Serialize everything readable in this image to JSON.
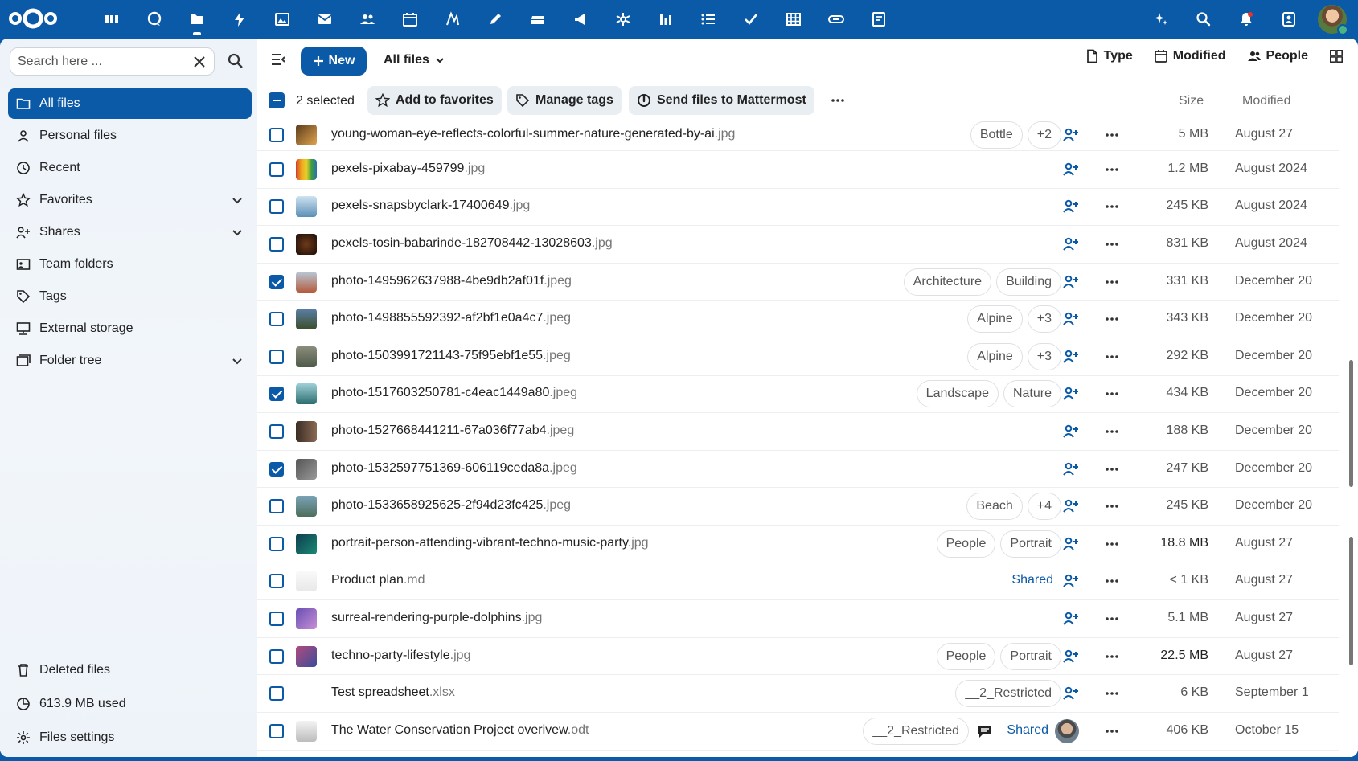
{
  "colors": {
    "brand": "#0b5aa7",
    "sidebar_bg": "#eef3f9",
    "selected_bg": "#0b5aa7"
  },
  "topbar": {
    "apps": [
      "dashboard-icon",
      "talk-icon",
      "files-icon",
      "activity-icon",
      "photos-icon",
      "mail-icon",
      "contacts-icon",
      "calendar-icon",
      "text-icon",
      "notes-icon",
      "deck-icon",
      "announcement-icon",
      "spreed-icon",
      "analytics-icon",
      "tasks-icon",
      "checklist-icon",
      "tables-icon",
      "links-icon",
      "forms-icon"
    ],
    "right": [
      "assistant-icon",
      "unified-search-icon",
      "notifications-icon",
      "contacts-menu-icon"
    ]
  },
  "sidebar": {
    "search": {
      "placeholder": "Search here ..."
    },
    "items": [
      {
        "label": "All files",
        "icon": "folder-icon"
      },
      {
        "label": "Personal files",
        "icon": "account-icon"
      },
      {
        "label": "Recent",
        "icon": "history-icon"
      },
      {
        "label": "Favorites",
        "icon": "star-icon"
      },
      {
        "label": "Shares",
        "icon": "share-icon"
      },
      {
        "label": "Team folders",
        "icon": "team-folder-icon"
      },
      {
        "label": "Tags",
        "icon": "tag-icon"
      },
      {
        "label": "External storage",
        "icon": "external-storage-icon"
      },
      {
        "label": "Folder tree",
        "icon": "folder-tree-icon"
      }
    ],
    "bottom": [
      {
        "label": "Deleted files",
        "icon": "trash-icon"
      },
      {
        "label": "613.9 MB used",
        "icon": "storage-pie-icon"
      },
      {
        "label": "Files settings",
        "icon": "cog-icon"
      }
    ]
  },
  "toolbar": {
    "new_label": "New",
    "breadcrumb": "All files",
    "view": {
      "type": "Type",
      "modified": "Modified",
      "people": "People"
    }
  },
  "selection": {
    "count_label": "2 selected",
    "actions": [
      "Add to favorites",
      "Manage tags",
      "Send files to Mattermost"
    ]
  },
  "columns": {
    "size": "Size",
    "modified": "Modified"
  },
  "files": [
    {
      "base": "young-woman-eye-reflects-colorful-summer-nature-generated-by-ai",
      "ext": ".jpg",
      "tags": [
        "Bottle",
        "+2"
      ],
      "size": "5 MB",
      "modified": "August 27",
      "checked": false,
      "thumb": "linear-gradient(135deg,#5a3b1c,#e1a54d)"
    },
    {
      "base": "pexels-pixabay-459799",
      "ext": ".jpg",
      "tags": [],
      "size": "1.2 MB",
      "modified": "August 2024",
      "checked": false,
      "thumb": "linear-gradient(90deg,#d13a2e,#f0a11c,#e9d12c,#3c9d3f,#2b6fb3)"
    },
    {
      "base": "pexels-snapsbyclark-17400649",
      "ext": ".jpg",
      "tags": [],
      "size": "245 KB",
      "modified": "August 2024",
      "checked": false,
      "thumb": "linear-gradient(180deg,#cfe3f1,#5c8fb6)"
    },
    {
      "base": "pexels-tosin-babarinde-182708442-13028603",
      "ext": ".jpg",
      "tags": [],
      "size": "831 KB",
      "modified": "August 2024",
      "checked": false,
      "thumb": "radial-gradient(circle,#6e3a1a,#1c0d06)"
    },
    {
      "base": "photo-1495962637988-4be9db2af01f",
      "ext": ".jpeg",
      "tags": [
        "Architecture",
        "Building"
      ],
      "size": "331 KB",
      "modified": "December 20",
      "checked": true,
      "thumb": "linear-gradient(180deg,#b9c9d8,#b45c3e)"
    },
    {
      "base": "photo-1498855592392-af2bf1e0a4c7",
      "ext": ".jpeg",
      "tags": [
        "Alpine",
        "+3"
      ],
      "size": "343 KB",
      "modified": "December 20",
      "checked": false,
      "thumb": "linear-gradient(180deg,#5b7fa8,#3b4d2a)"
    },
    {
      "base": "photo-1503991721143-75f95ebf1e55",
      "ext": ".jpeg",
      "tags": [
        "Alpine",
        "+3"
      ],
      "size": "292 KB",
      "modified": "December 20",
      "checked": false,
      "thumb": "linear-gradient(180deg,#8a8d7a,#4f5a4a)"
    },
    {
      "base": "photo-1517603250781-c4eac1449a80",
      "ext": ".jpeg",
      "tags": [
        "Landscape",
        "Nature"
      ],
      "size": "434 KB",
      "modified": "December 20",
      "checked": true,
      "thumb": "linear-gradient(180deg,#9fd0d8,#2b6d6e)"
    },
    {
      "base": "photo-1527668441211-67a036f77ab4",
      "ext": ".jpeg",
      "tags": [],
      "size": "188 KB",
      "modified": "December 20",
      "checked": false,
      "thumb": "linear-gradient(90deg,#3a2c24,#8a6a54)"
    },
    {
      "base": "photo-1532597751369-606119ceda8a",
      "ext": ".jpeg",
      "tags": [],
      "size": "247 KB",
      "modified": "December 20",
      "checked": true,
      "thumb": "linear-gradient(135deg,#555,#999)"
    },
    {
      "base": "photo-1533658925625-2f94d23fc425",
      "ext": ".jpeg",
      "tags": [
        "Beach",
        "+4"
      ],
      "size": "245 KB",
      "modified": "December 20",
      "checked": false,
      "thumb": "linear-gradient(180deg,#7aa3b8,#4d6e5a)"
    },
    {
      "base": "portrait-person-attending-vibrant-techno-music-party",
      "ext": ".jpg",
      "tags": [
        "People",
        "Portrait"
      ],
      "size": "18.8 MB",
      "modified": "August 27",
      "checked": false,
      "thumb": "linear-gradient(135deg,#0e3c4f,#1b8a74)"
    },
    {
      "base": "Product plan",
      "ext": ".md",
      "tags": [],
      "shared": "Shared",
      "size": "< 1 KB",
      "modified": "August 27",
      "checked": false,
      "thumb": "linear-gradient(180deg,#fafafa,#e8e8e8)"
    },
    {
      "base": "surreal-rendering-purple-dolphins",
      "ext": ".jpg",
      "tags": [],
      "size": "5.1 MB",
      "modified": "August 27",
      "checked": false,
      "thumb": "linear-gradient(135deg,#6a4fb3,#c78fd6)"
    },
    {
      "base": "techno-party-lifestyle",
      "ext": ".jpg",
      "tags": [
        "People",
        "Portrait"
      ],
      "size": "22.5 MB",
      "modified": "August 27",
      "checked": false,
      "thumb": "linear-gradient(135deg,#b04b7d,#3c4c9a)"
    },
    {
      "base": "Test spreadsheet",
      "ext": ".xlsx",
      "tags": [
        "__2_Restricted"
      ],
      "size": "6 KB",
      "modified": "September 1",
      "checked": false,
      "thumb": ""
    },
    {
      "base": "The Water Conservation Project overivew",
      "ext": ".odt",
      "tags": [
        "__2_Restricted"
      ],
      "shared": "Shared",
      "comment": true,
      "avatar": true,
      "size": "406 KB",
      "modified": "October 15",
      "checked": false,
      "thumb": "linear-gradient(180deg,#f3f3f3,#bdbdbd)"
    }
  ]
}
